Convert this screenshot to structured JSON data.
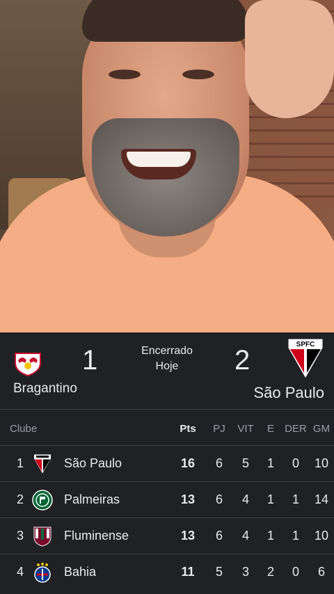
{
  "match": {
    "home_team": "Bragantino",
    "away_team": "São Paulo",
    "home_score": "1",
    "away_score": "2",
    "status": "Encerrado",
    "date": "Hoje",
    "away_crest_text": "SPFC"
  },
  "standings": {
    "headers": {
      "club": "Clube",
      "pts": "Pts",
      "pj": "PJ",
      "vit": "VIT",
      "e": "E",
      "der": "DER",
      "gm": "GM"
    },
    "rows": [
      {
        "pos": "1",
        "club": "São Paulo",
        "pts": "16",
        "pj": "6",
        "vit": "5",
        "e": "1",
        "der": "0",
        "gm": "10",
        "badge_icon": "sao-paulo-crest-icon"
      },
      {
        "pos": "2",
        "club": "Palmeiras",
        "pts": "13",
        "pj": "6",
        "vit": "4",
        "e": "1",
        "der": "1",
        "gm": "14",
        "badge_icon": "palmeiras-crest-icon"
      },
      {
        "pos": "3",
        "club": "Fluminense",
        "pts": "13",
        "pj": "6",
        "vit": "4",
        "e": "1",
        "der": "1",
        "gm": "10",
        "badge_icon": "fluminense-crest-icon"
      },
      {
        "pos": "4",
        "club": "Bahia",
        "pts": "11",
        "pj": "5",
        "vit": "3",
        "e": "2",
        "der": "0",
        "gm": "6",
        "badge_icon": "bahia-crest-icon"
      }
    ]
  },
  "colors": {
    "background": "#202124",
    "text": "#e8eaed",
    "muted": "#9aa0a6",
    "divider": "#3c4043"
  }
}
